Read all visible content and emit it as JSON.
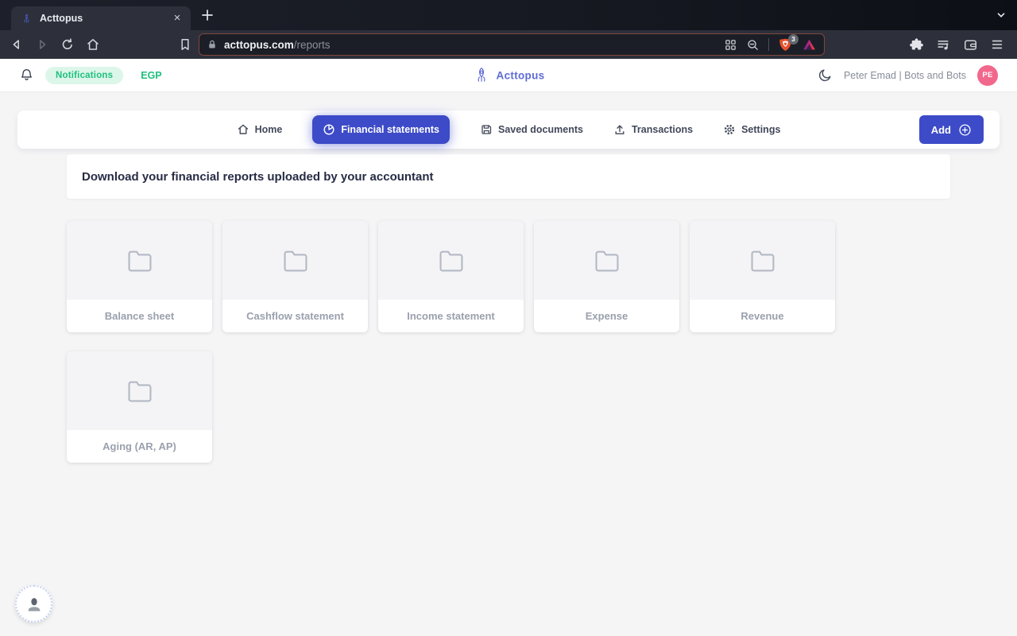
{
  "colors": {
    "accent": "#3d4bc8",
    "green": "#1fc07d",
    "green_bg": "#ddf6ea",
    "pink": "#f2688c",
    "logo": "#5e6bd6",
    "shield": "#e8502b"
  },
  "browser": {
    "tab_title": "Acttopus",
    "close_glyph": "×",
    "url_domain": "acttopus.com",
    "url_path": "/reports",
    "shield_badge": "3"
  },
  "header": {
    "notifications": "Notifications",
    "currency": "EGP",
    "logo": "Acttopus",
    "user": "Peter Emad | Bots and Bots",
    "initials": "PE"
  },
  "nav": {
    "items": [
      {
        "label": "Home"
      },
      {
        "label": "Financial statements",
        "active": true
      },
      {
        "label": "Saved documents"
      },
      {
        "label": "Transactions"
      },
      {
        "label": "Settings"
      }
    ],
    "add": "Add"
  },
  "banner": "Download your financial reports uploaded by your accountant",
  "cards": [
    {
      "label": "Balance sheet"
    },
    {
      "label": "Cashflow statement"
    },
    {
      "label": "Income statement"
    },
    {
      "label": "Expense"
    },
    {
      "label": "Revenue"
    },
    {
      "label": "Aging (AR, AP)"
    }
  ]
}
